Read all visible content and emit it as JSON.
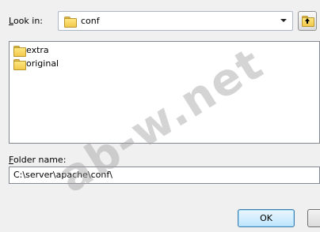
{
  "lookin": {
    "label": "Look in:",
    "label_accel": "L",
    "label_rest": "ook in:",
    "value": "conf",
    "folder_icon": "folder-icon"
  },
  "up_button": {
    "icon": "folder-up-icon"
  },
  "folder_list": {
    "items": [
      {
        "label": "extra",
        "icon": "folder-icon"
      },
      {
        "label": "original",
        "icon": "folder-icon"
      }
    ]
  },
  "foldername": {
    "label": "Folder name:",
    "label_accel": "F",
    "label_rest": "older name:",
    "value": "C:\\server\\apache\\conf\\"
  },
  "buttons": {
    "ok": "OK",
    "cancel": ""
  },
  "watermark": "ab-w.net",
  "colors": {
    "accent": "#3c7fb1",
    "folder": "#f2c94c",
    "background": "#f0f0f0"
  }
}
